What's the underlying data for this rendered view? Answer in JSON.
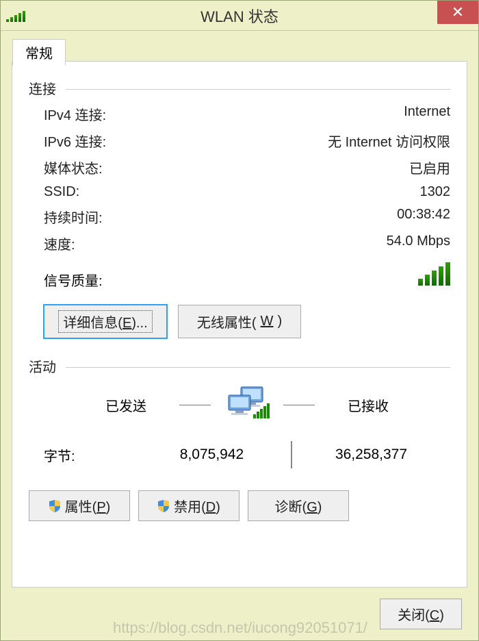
{
  "window": {
    "title": "WLAN 状态",
    "close_tooltip": "关闭"
  },
  "tab": {
    "general": "常规"
  },
  "connection": {
    "section": "连接",
    "ipv4_label": "IPv4 连接:",
    "ipv4_value": "Internet",
    "ipv6_label": "IPv6 连接:",
    "ipv6_value": "无 Internet 访问权限",
    "media_label": "媒体状态:",
    "media_value": "已启用",
    "ssid_label": "SSID:",
    "ssid_value": "1302",
    "duration_label": "持续时间:",
    "duration_value": "00:38:42",
    "speed_label": "速度:",
    "speed_value": "54.0 Mbps",
    "signal_label": "信号质量:"
  },
  "buttons": {
    "details_prefix": "详细信息(",
    "details_access": "E",
    "details_suffix": ")...",
    "wireless_prefix": "无线属性(",
    "wireless_access": "W",
    "wireless_suffix": ")",
    "properties_prefix": "属性(",
    "properties_access": "P",
    "properties_suffix": ")",
    "disable_prefix": "禁用(",
    "disable_access": "D",
    "disable_suffix": ")",
    "diagnose_prefix": "诊断(",
    "diagnose_access": "G",
    "diagnose_suffix": ")",
    "close_prefix": "关闭(",
    "close_access": "C",
    "close_suffix": ")"
  },
  "activity": {
    "section": "活动",
    "sent_label": "已发送",
    "received_label": "已接收",
    "bytes_label": "字节:",
    "bytes_sent": "8,075,942",
    "bytes_received": "36,258,377"
  },
  "watermark": "https://blog.csdn.net/iucong92051071/"
}
